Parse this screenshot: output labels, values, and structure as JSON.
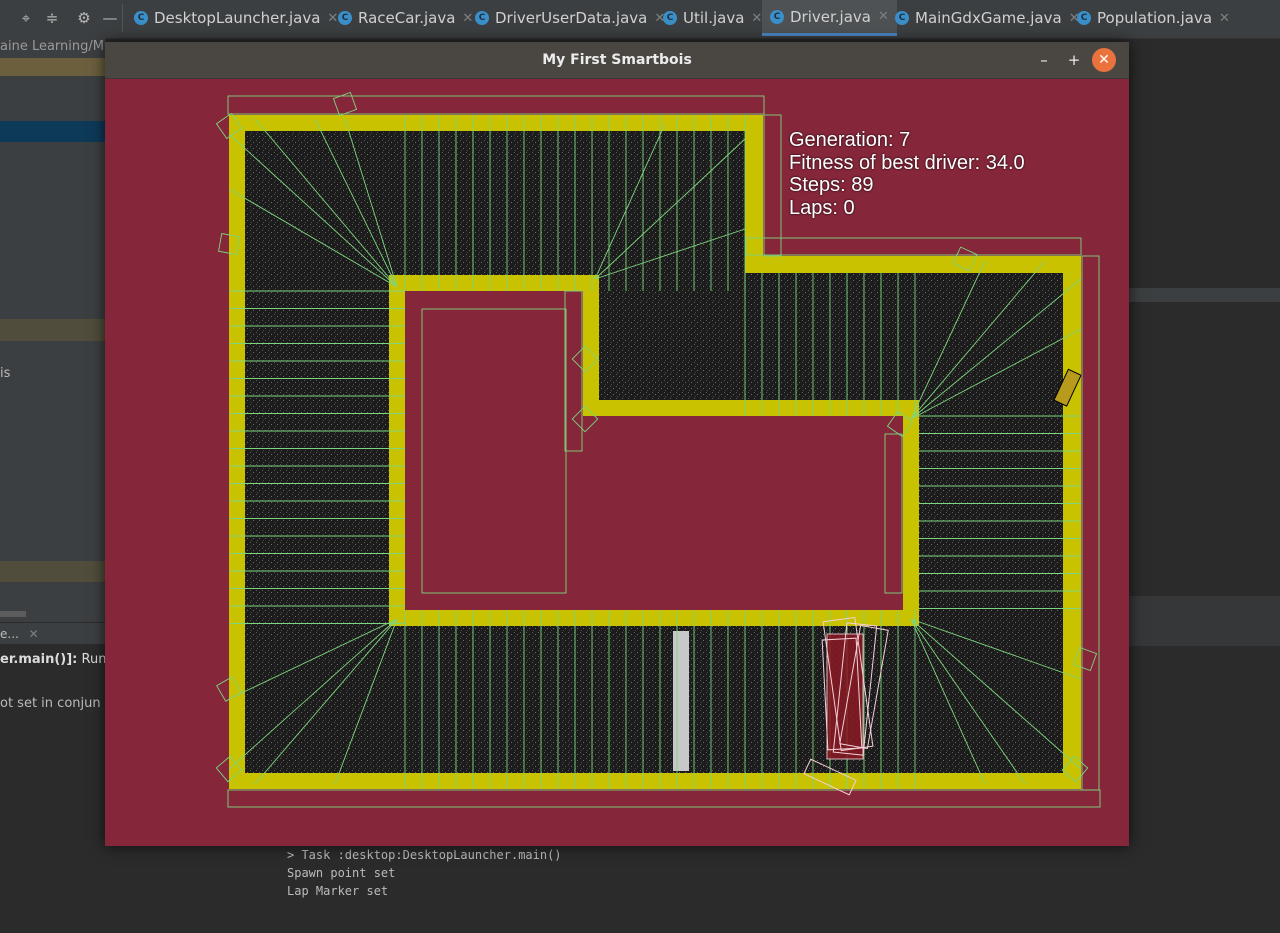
{
  "ide": {
    "tabs": [
      {
        "label": "DesktopLauncher.java"
      },
      {
        "label": "RaceCar.java"
      },
      {
        "label": "DriverUserData.java"
      },
      {
        "label": "Util.java"
      },
      {
        "label": "Driver.java",
        "active": true
      },
      {
        "label": "MainGdxGame.java"
      },
      {
        "label": "Population.java"
      }
    ],
    "tab_close_glyph": "✕",
    "class_icon_letter": "C",
    "toolbar_icons": [
      "target-icon",
      "collapse-icon",
      "gear-icon",
      "minimize-icon"
    ],
    "left_panel": {
      "path_fragment": "aine Learning/M",
      "item_fragment": "is",
      "run_tab": "e...",
      "run_text": "er.main()]:",
      "run_text2": "Run",
      "warning_fragment": "ot set in conjun"
    },
    "console_lines": [
      "> Task :desktop:DesktopLauncher.main()",
      "Spawn point set",
      "Lap Marker set"
    ]
  },
  "game_window": {
    "title": "My First Smartbois",
    "minimize_glyph": "–",
    "maximize_glyph": "+",
    "close_glyph": "✕"
  },
  "hud": {
    "generation": "Generation: 7",
    "fitness": "Fitness of best driver: 34.0",
    "steps": "Steps: 89",
    "laps": "Laps: 0"
  },
  "colors": {
    "background": "#86263a",
    "track_border": "#c9c200",
    "asphalt": "#1c1c1c",
    "sensor_lines": "#7dd67d",
    "finish_line": "#c8c8c8"
  }
}
